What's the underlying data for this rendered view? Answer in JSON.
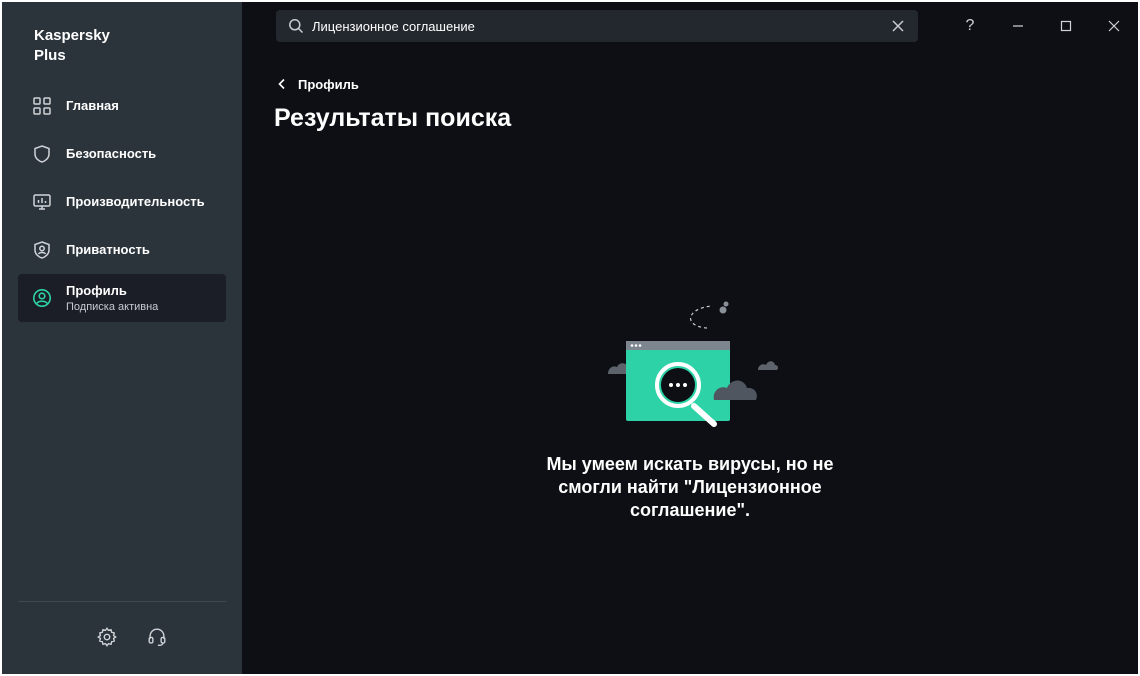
{
  "app": {
    "title_line1": "Kaspersky",
    "title_line2": "Plus"
  },
  "sidebar": {
    "items": [
      {
        "label": "Главная",
        "icon": "home-grid-icon"
      },
      {
        "label": "Безопасность",
        "icon": "shield-icon"
      },
      {
        "label": "Производительность",
        "icon": "monitor-icon"
      },
      {
        "label": "Приватность",
        "icon": "privacy-shield-icon"
      },
      {
        "label": "Профиль",
        "sublabel": "Подписка активна",
        "icon": "profile-icon",
        "active": true
      }
    ],
    "footer": {
      "settings_icon": "gear-icon",
      "support_icon": "headset-icon"
    }
  },
  "search": {
    "value": "Лицензионное соглашение",
    "placeholder": ""
  },
  "window_controls": {
    "help": "?"
  },
  "breadcrumb": {
    "back_label": "Профиль"
  },
  "page": {
    "title": "Результаты поиска",
    "empty_message": "Мы умеем искать вирусы, но не смогли найти \"Лицензионное соглашение\"."
  },
  "colors": {
    "accent": "#2dd3a6",
    "sidebar_bg": "#2b343b",
    "main_bg": "#0e0f14",
    "active_item_bg": "#1b1e27"
  }
}
